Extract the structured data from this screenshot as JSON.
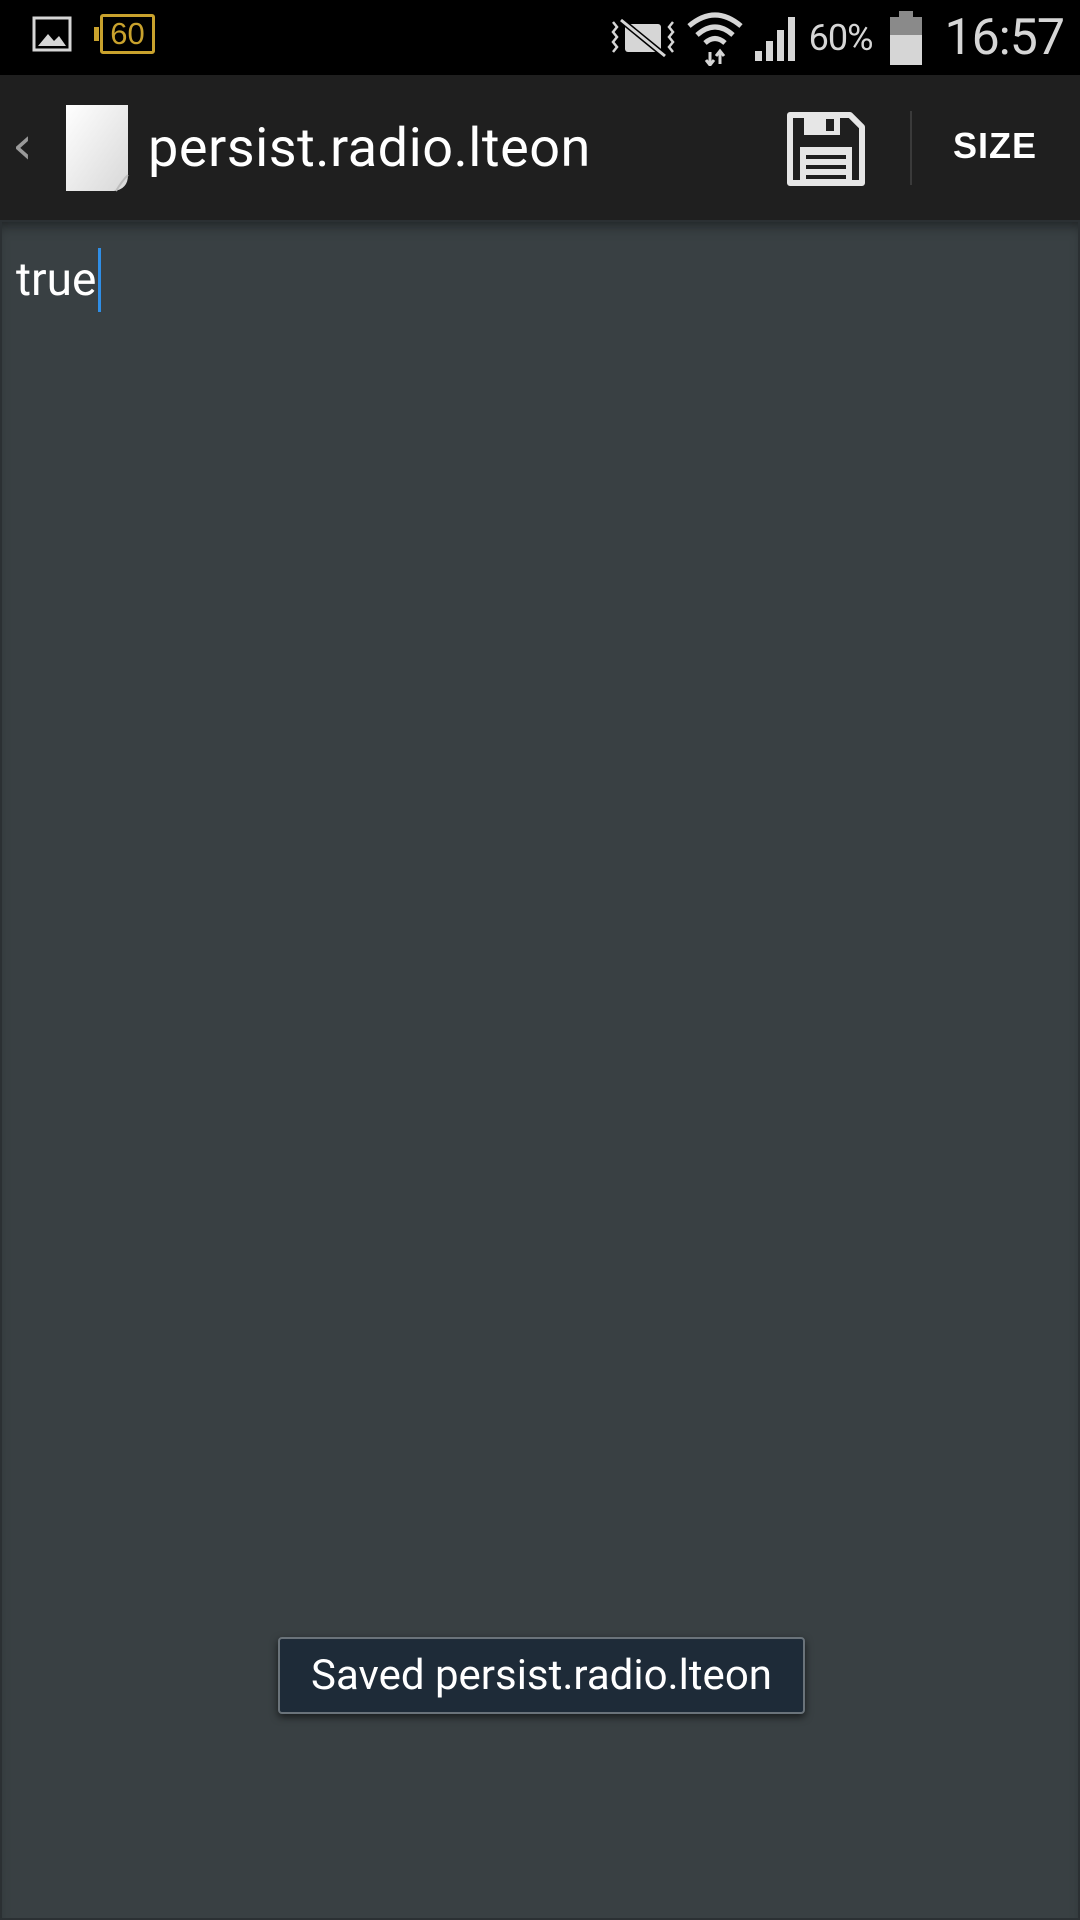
{
  "status_bar": {
    "notification_icons": [
      "gallery-icon",
      "battery-60-badge-icon"
    ],
    "badge_text": "60",
    "system_icons": [
      "vibrate-icon",
      "wifi-icon",
      "cell-signal-icon",
      "battery-icon"
    ],
    "battery_percent": "60%",
    "time": "16:57"
  },
  "action_bar": {
    "title": "persist.radio.lteon",
    "save_icon": "floppy-disk-icon",
    "size_label": "SIZE"
  },
  "editor": {
    "content": "true"
  },
  "toast": {
    "message": "Saved persist.radio.lteon"
  },
  "colors": {
    "editor_background": "#394043",
    "action_bar_background": "#1f1f1f",
    "cursor": "#2f8ee6",
    "badge": "#c9a22d",
    "toast_background": "#1e2b38"
  }
}
